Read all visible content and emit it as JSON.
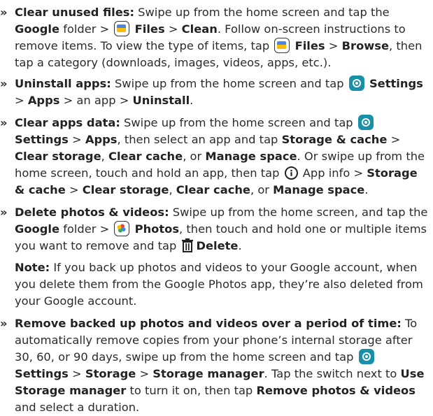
{
  "bullet": "»",
  "items": {
    "clear_unused": {
      "title": "Clear unused files:",
      "t1": " Swipe up from the home screen and tap the ",
      "google": "Google",
      "t2": " folder > ",
      "files": "Files",
      "t3": " > ",
      "clean": "Clean",
      "t4": ". Follow on-screen instructions to remove items. To view the type of items, tap ",
      "files2": "Files",
      "t5": " > ",
      "browse": "Browse",
      "t6": ", then tap a category (downloads, images, videos, apps, etc.)."
    },
    "uninstall": {
      "title": "Uninstall apps:",
      "t1": " Swipe up from the home screen and tap ",
      "settings": "Settings",
      "t2": " > ",
      "apps": "Apps",
      "t3": " > an app > ",
      "uninstall": "Uninstall",
      "t4": "."
    },
    "clear_data": {
      "title": "Clear apps data:",
      "t1": " Swipe up from the home screen and tap ",
      "settings": "Settings",
      "t2": " > ",
      "apps": "Apps",
      "t3": ", then select an app and tap ",
      "storage_cache": "Storage & cache",
      "t4": " > ",
      "clear_storage": "Clear storage",
      "t5": ", ",
      "clear_cache": "Clear cache",
      "t6": ", or ",
      "manage_space": "Manage space",
      "t7": ". Or swipe up from the home screen, touch and hold an app, then tap ",
      "t8": "App info > ",
      "storage_cache2": "Storage & cache",
      "t9": " > ",
      "clear_storage2": "Clear storage",
      "t10": ", ",
      "clear_cache2": "Clear cache",
      "t11": ", or ",
      "manage_space2": "Manage space",
      "t12": "."
    },
    "delete_photos": {
      "title": "Delete photos & videos:",
      "t1": " Swipe up from the home screen, and tap the ",
      "google": "Google",
      "t2": " folder > ",
      "photos": "Photos",
      "t3": ", then touch and hold one or multiple items you want to remove and tap ",
      "delete": "Delete",
      "t4": "."
    },
    "note": {
      "label": "Note:",
      "text": " If you back up photos and videos to your Google account, when you delete them from the Google Photos app, they’re also deleted from your Google account."
    },
    "remove_backed": {
      "title": "Remove backed up photos and videos over a period of time:",
      "t1": " To automatically remove copies from your phone’s internal storage after 30, 60, or 90 days, swipe up from the home screen and tap ",
      "settings": "Settings",
      "t2": " > ",
      "storage": "Storage",
      "t3": " > ",
      "storage_manager": "Storage manager",
      "t4": ". Tap the switch next to ",
      "use_storage_manager": "Use Storage manager",
      "t5": " to turn it on, then tap ",
      "remove_pv": "Remove photos & videos",
      "t6": " and select a duration."
    }
  }
}
